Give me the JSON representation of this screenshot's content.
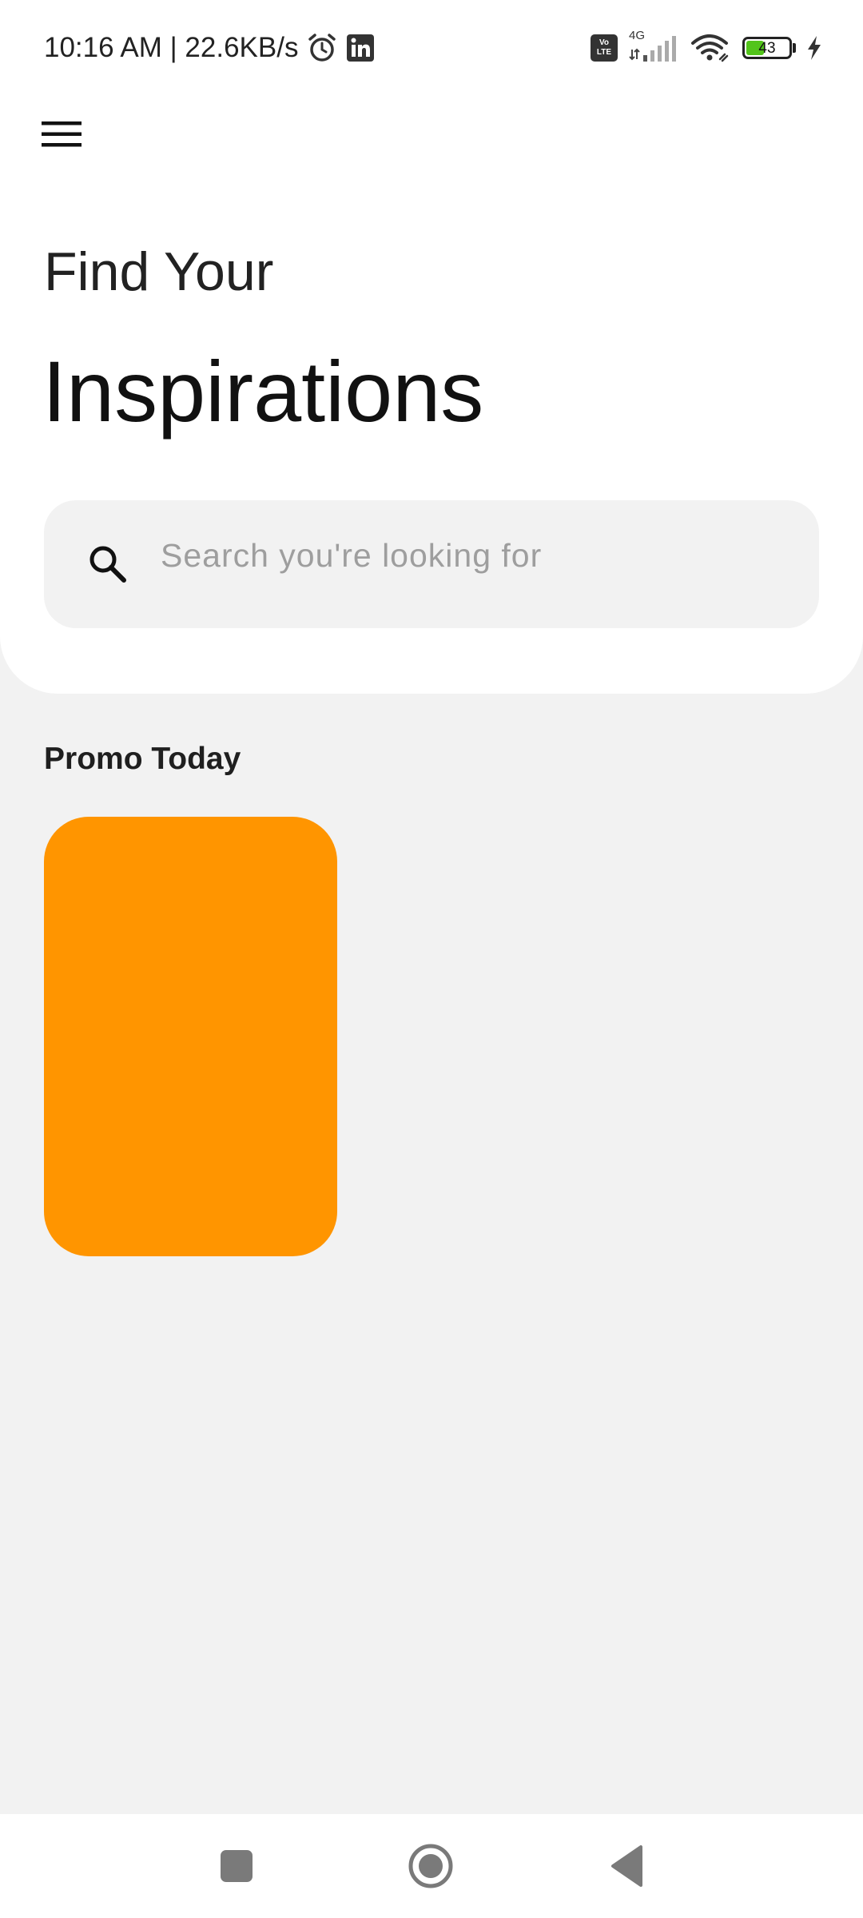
{
  "status_bar": {
    "time_speed": "10:16 AM | 22.6KB/s",
    "alarm_icon": "alarm-clock-icon",
    "linkedin_icon": "linkedin-icon",
    "volte_top": "Vo",
    "volte_bottom": "LTE",
    "network_type": "4G",
    "battery_level": "43",
    "battery_fraction": 0.43,
    "battery_color": "#52c41a",
    "charging_icon": "lightning-bolt-icon"
  },
  "header": {
    "menu_icon": "hamburger-menu-icon",
    "subtitle": "Find Your",
    "title": "Inspirations"
  },
  "search": {
    "icon": "search-icon",
    "placeholder": "Search you're looking for",
    "value": ""
  },
  "promo": {
    "section_title": "Promo Today",
    "cards": [
      {
        "color": "#ff9500"
      }
    ]
  },
  "nav_bar": {
    "recents_icon": "square-recents-icon",
    "home_icon": "circle-home-icon",
    "back_icon": "triangle-back-icon"
  },
  "colors": {
    "background": "#f2f2f2",
    "card_background": "#ffffff",
    "search_background": "#f2f2f2",
    "placeholder_text": "#9e9e9e",
    "accent_promo": "#ff9500"
  }
}
